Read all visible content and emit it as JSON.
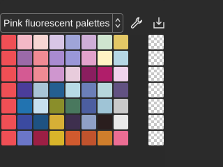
{
  "palette_selector": {
    "selected": "Pink fluorescent palettes"
  },
  "icons": {
    "settings": "wrench-icon",
    "import": "download-icon",
    "dropdown": "chevron-up-down-icon"
  },
  "swatch_columns": 9,
  "swatches": [
    [
      "#ef4f55",
      "#f3b8c6",
      "#f7d6d3",
      "#d8c6e6",
      "#9fa4d8",
      "#cfaed7",
      "#cfe5cf",
      "#e3c866",
      "transparent"
    ],
    [
      "#ef4f55",
      "#9b6aa8",
      "#f08b94",
      "#a98bd1",
      "#9a97d8",
      "#e2a2cc",
      "#fff3c4",
      "#b5d7e5",
      "transparent"
    ],
    [
      "#ef4f55",
      "#d45a93",
      "#f08b94",
      "#cf96cf",
      "#e8ccdc",
      "#8a1e5f",
      "#b01e6a",
      "#efd3ec",
      "transparent"
    ],
    [
      "#ef4f55",
      "#4b3d9a",
      "#a9c5d6",
      "#245f91",
      "#b7dbe6",
      "#6b7fb8",
      "#b7d7dc",
      "#625282",
      "transparent"
    ],
    [
      "#ef4f55",
      "#2273b0",
      "#c7e0ef",
      "#8a8e2a",
      "#49785e",
      "#4c5ea0",
      "#9fc4d6",
      "#cacaca",
      "transparent"
    ],
    [
      "#ef4f55",
      "#3b4aa0",
      "#1e5282",
      "#d6af36",
      "#3e2f4e",
      "#8fa0c6",
      "#2a1e1e",
      "#e9e9e9",
      "transparent"
    ],
    [
      "#ef4f55",
      "#6b76c8",
      "#9c1f44",
      "#d8b42a",
      "#d05a2e",
      "#c0532d",
      "#cf7e2c",
      "#eb6d93",
      "transparent"
    ]
  ]
}
